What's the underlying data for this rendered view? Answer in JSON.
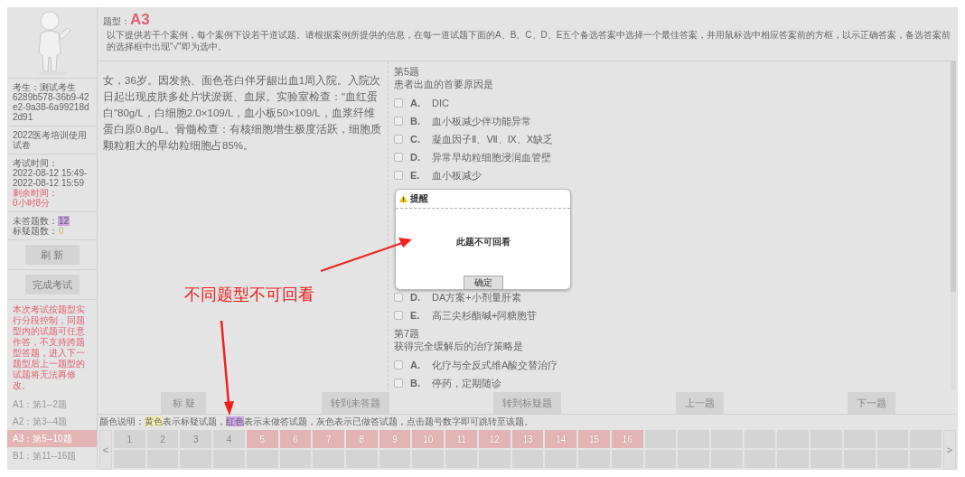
{
  "sidebar": {
    "examinee_label": "考生：测试考生",
    "examinee_id": "6289b578-36b9-42e2-9a38-6a99218d2d91",
    "paper": "2022医考培训使用试卷",
    "time_label": "考试时间：",
    "time_start": "2022-08-12 15:49-",
    "time_end": "2022-08-12 15:59",
    "remaining_label": "剩余时间：",
    "remaining": "0小时8分",
    "unanswered_label": "未答题数：",
    "unanswered": "12",
    "flagged_label": "标疑题数：",
    "flagged": "0",
    "buttons": [
      "刷 新",
      "完成考试"
    ],
    "notice": "本次考试按题型实行分段控制，同题型内的试题可任意作答，不支持跨题型答题，进入下一题型后上一题型的试题将无法再修改。",
    "sections": [
      {
        "label": "A1：第1--2题",
        "selected": false
      },
      {
        "label": "A2：第3--4题",
        "selected": false
      },
      {
        "label": "A3：第5--10题",
        "selected": true
      },
      {
        "label": "B1：第11--16题",
        "selected": false
      }
    ]
  },
  "header": {
    "type_label": "题型：",
    "type": "A3",
    "instruction": "以下提供若干个案例，每个案例下设若干道试题。请根据案例所提供的信息，在每一道试题下面的A、B、C、D、E五个备选答案中选择一个最佳答案，并用鼠标选中相应答案前的方框，以示正确答案，备选答案前的选择框中出现\"√\"即为选中。"
  },
  "case_text": "女，36岁。因发热、面色苍白伴牙龈出血1周入院。入院次日起出现皮肤多处片状淤斑、血尿。实验室检查：\"血红蛋白\"80g/L，白细胞2.0×109/L，血小板50×109/L，血浆纤维蛋白原0.8g/L。骨髓检查：有核细胞增生极度活跃，细胞质颗粒粗大的早幼粒细胞占85%。",
  "questions": [
    {
      "number": "第5题",
      "stem": "患者出血的首要原因是",
      "options": [
        {
          "letter": "A.",
          "text": "DIC",
          "checked": false
        },
        {
          "letter": "B.",
          "text": "血小板减少伴功能异常",
          "checked": false
        },
        {
          "letter": "C.",
          "text": "凝血因子Ⅱ、Ⅶ、Ⅸ、Ⅹ缺乏",
          "checked": false
        },
        {
          "letter": "D.",
          "text": "异常早幼粒细胞浸润血管壁",
          "checked": false
        },
        {
          "letter": "E.",
          "text": "血小板减少",
          "checked": false
        }
      ]
    },
    {
      "options": [
        {
          "letter": "D.",
          "text": "DA方案+小剂量肝素",
          "checked": false
        },
        {
          "letter": "E.",
          "text": "高三尖杉酯碱+阿糖胞苷",
          "checked": false
        }
      ]
    },
    {
      "number": "第7题",
      "stem": "获得完全缓解后的治疗策略是",
      "options": [
        {
          "letter": "A.",
          "text": "化疗与全反式维A酸交替治疗",
          "checked": false
        },
        {
          "letter": "B.",
          "text": "停药，定期随诊",
          "checked": false
        }
      ]
    }
  ],
  "actions": [
    "标 疑",
    "转到未答题",
    "转到标疑题",
    "上一题",
    "下一题"
  ],
  "legend": [
    {
      "text": "颜色说明："
    },
    {
      "text": "黄色",
      "color": "#f3eeb0"
    },
    {
      "text": "表示标疑试题，"
    },
    {
      "text": "红色",
      "color": "#c9a3e0"
    },
    {
      "text": "表示未做答试题，灰色表示已做答试题，点击题号数字即可跳转至该题。"
    }
  ],
  "grid_prev": "<",
  "grid_next": ">",
  "grid": [
    {
      "number": "1",
      "answered": true
    },
    {
      "number": "2",
      "answered": true
    },
    {
      "number": "3",
      "answered": true
    },
    {
      "number": "4",
      "answered": true
    },
    {
      "number": "5",
      "answered": false
    },
    {
      "number": "6",
      "answered": false
    },
    {
      "number": "7",
      "answered": false
    },
    {
      "number": "8",
      "answered": false
    },
    {
      "number": "9",
      "answered": false
    },
    {
      "number": "10",
      "answered": false
    },
    {
      "number": "11",
      "answered": false
    },
    {
      "number": "12",
      "answered": false
    },
    {
      "number": "13",
      "answered": false
    },
    {
      "number": "14",
      "answered": false
    },
    {
      "number": "15",
      "answered": false
    },
    {
      "number": "16",
      "answered": false
    }
  ],
  "dialog": {
    "title": "提醒",
    "message": "此题不可回看",
    "button": "确定"
  },
  "annotation": {
    "text": "不同题型不可回看"
  }
}
